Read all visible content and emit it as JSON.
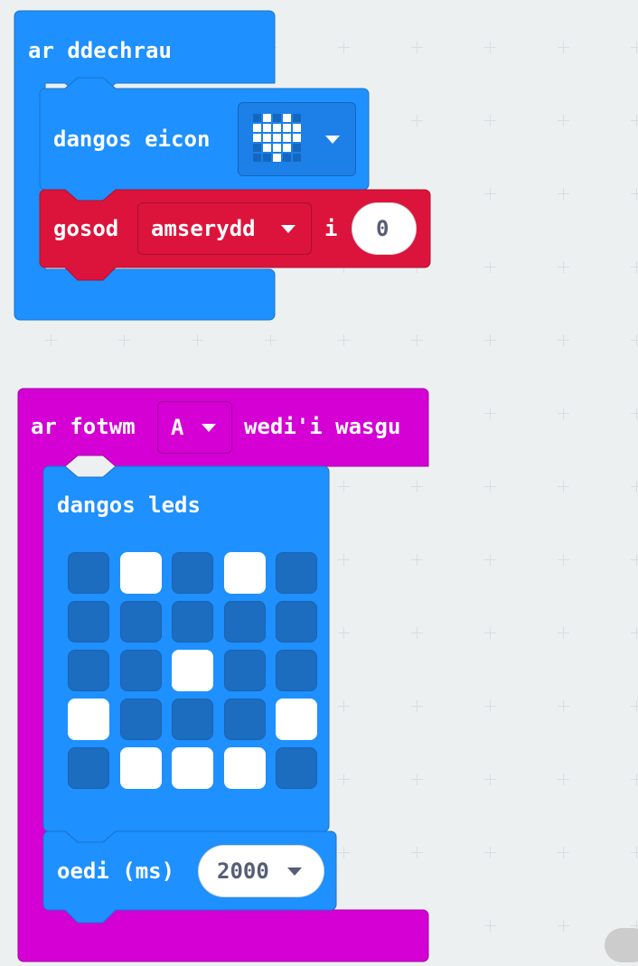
{
  "workspace": {
    "on_start": {
      "label": "ar ddechrau",
      "color": "#1e90ff",
      "show_icon": {
        "label": "dangos eicon",
        "icon": "heart-icon",
        "icon_pattern": [
          [
            0,
            1,
            0,
            1,
            0
          ],
          [
            1,
            1,
            1,
            1,
            1
          ],
          [
            1,
            1,
            1,
            1,
            1
          ],
          [
            0,
            1,
            1,
            1,
            0
          ],
          [
            0,
            0,
            1,
            0,
            0
          ]
        ]
      },
      "set_variable": {
        "label": "gosod",
        "variable": "amserydd",
        "to_label": "i",
        "value": "0",
        "color": "#dc143c"
      }
    },
    "on_button_pressed": {
      "label_prefix": "ar fotwm",
      "button": "A",
      "label_suffix": "wedi'i wasgu",
      "color": "#d400d4",
      "show_leds": {
        "label": "dangos leds",
        "leds": [
          [
            0,
            1,
            0,
            1,
            0
          ],
          [
            0,
            0,
            0,
            0,
            0
          ],
          [
            0,
            0,
            1,
            0,
            0
          ],
          [
            1,
            0,
            0,
            0,
            1
          ],
          [
            0,
            1,
            1,
            1,
            0
          ]
        ]
      },
      "pause": {
        "label": "oedi (ms)",
        "value": "2000"
      }
    }
  }
}
